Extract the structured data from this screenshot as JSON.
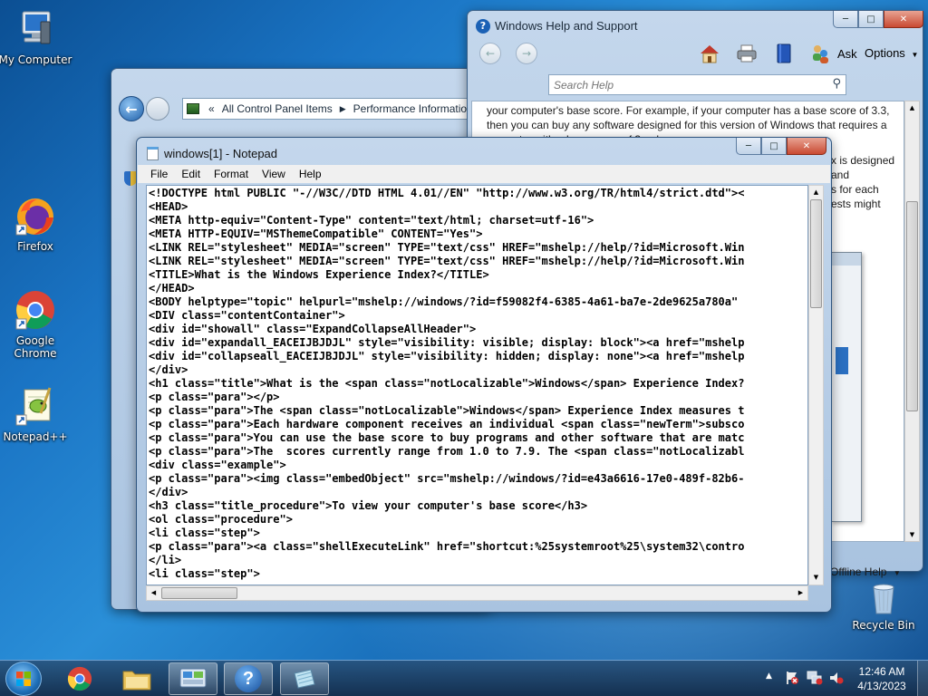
{
  "desktop": {
    "icons": [
      {
        "label": "My Computer"
      },
      {
        "label": "Firefox"
      },
      {
        "label": "Google Chrome"
      },
      {
        "label": "Notepad++"
      },
      {
        "label": "Recycle Bin"
      }
    ]
  },
  "control_panel": {
    "path_root": "«",
    "crumb1": "All Control Panel Items",
    "crumb2": "Performance Information"
  },
  "help": {
    "title": "Windows Help and Support",
    "ask": "Ask",
    "options": "Options",
    "search_placeholder": "Search Help",
    "text_lines": [
      "your computer's base score. For example, if your computer has a base score of 3.3,",
      "then you can buy any software designed for this version of Windows that requires a",
      "computer with a base score of 3 or lower."
    ],
    "side_fragments": [
      "x is designed",
      "and",
      "s for each",
      "ests might"
    ],
    "offline": "Offline Help"
  },
  "notepad": {
    "title": "windows[1] - Notepad",
    "menu": [
      "File",
      "Edit",
      "Format",
      "View",
      "Help"
    ],
    "lines": [
      "<!DOCTYPE html PUBLIC \"-//W3C//DTD HTML 4.01//EN\" \"http://www.w3.org/TR/html4/strict.dtd\"><",
      "<HEAD>",
      "<META http-equiv=\"Content-Type\" content=\"text/html; charset=utf-16\">",
      "<META HTTP-EQUIV=\"MSThemeCompatible\" CONTENT=\"Yes\">",
      "<LINK REL=\"stylesheet\" MEDIA=\"screen\" TYPE=\"text/css\" HREF=\"mshelp://help/?id=Microsoft.Win",
      "<LINK REL=\"stylesheet\" MEDIA=\"screen\" TYPE=\"text/css\" HREF=\"mshelp://help/?id=Microsoft.Win",
      "<TITLE>What is the Windows Experience Index?</TITLE>",
      "</HEAD>",
      "<BODY helptype=\"topic\" helpurl=\"mshelp://windows/?id=f59082f4-6385-4a61-ba7e-2de9625a780a\"",
      "<DIV class=\"contentContainer\">",
      "<div id=\"showall\" class=\"ExpandCollapseAllHeader\">",
      "<div id=\"expandall_EACEIJBJDJL\" style=\"visibility: visible; display: block\"><a href=\"mshelp",
      "<div id=\"collapseall_EACEIJBJDJL\" style=\"visibility: hidden; display: none\"><a href=\"mshelp",
      "</div>",
      "<h1 class=\"title\">What is the <span class=\"notLocalizable\">Windows</span> Experience Index?",
      "<p class=\"para\"></p>",
      "<p class=\"para\">The <span class=\"notLocalizable\">Windows</span> Experience Index measures t",
      "<p class=\"para\">Each hardware component receives an individual <span class=\"newTerm\">subsco",
      "<p class=\"para\">You can use the base score to buy programs and other software that are matc",
      "<p class=\"para\">The  scores currently range from 1.0 to 7.9. The <span class=\"notLocalizabl",
      "<div class=\"example\">",
      "<p class=\"para\"><img class=\"embedObject\" src=\"mshelp://windows/?id=e43a6616-17e0-489f-82b6-",
      "</div>",
      "<h3 class=\"title_procedure\">To view your computer's base score</h3>",
      "<ol class=\"procedure\">",
      "<li class=\"step\">",
      "<p class=\"para\"><a class=\"shellExecuteLink\" href=\"shortcut:%25systemroot%25\\system32\\contro",
      "</li>",
      "<li class=\"step\">"
    ]
  },
  "taskbar": {
    "time": "12:46 AM",
    "date": "4/13/2023"
  }
}
